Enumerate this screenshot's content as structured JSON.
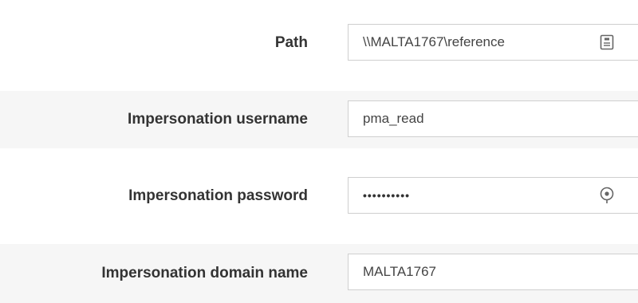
{
  "fields": [
    {
      "label": "Path",
      "value": "\\\\MALTA1767\\reference",
      "icon": "file-browse-icon"
    },
    {
      "label": "Impersonation username",
      "value": "pma_read"
    },
    {
      "label": "Impersonation password",
      "value": "••••••••••",
      "icon": "eye-reveal-icon"
    },
    {
      "label": "Impersonation domain name",
      "value": "MALTA1767"
    }
  ]
}
